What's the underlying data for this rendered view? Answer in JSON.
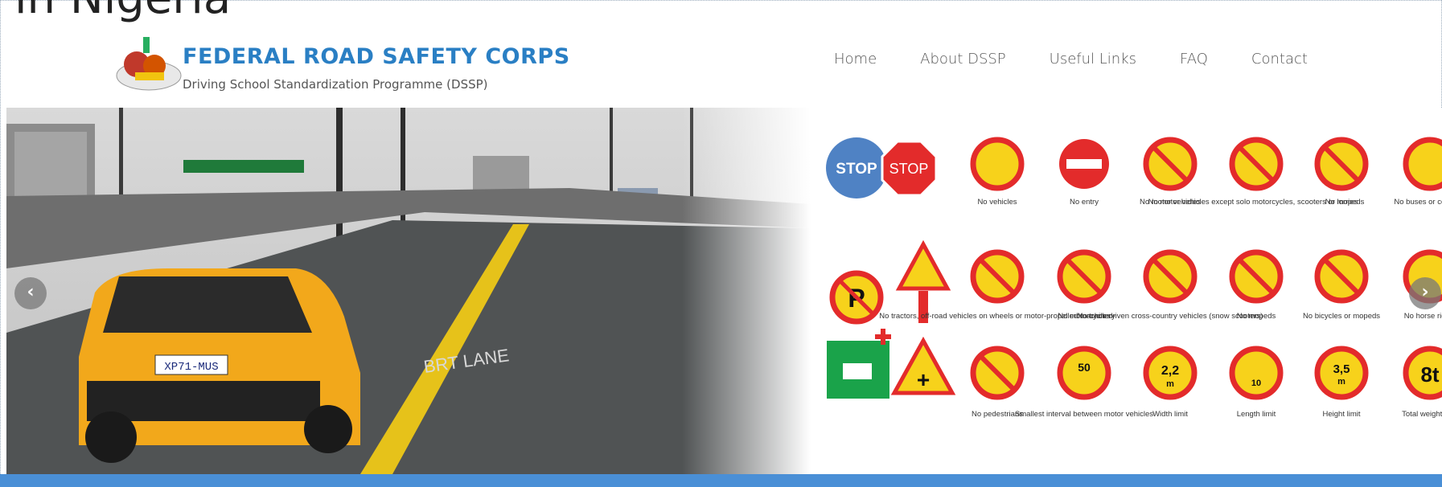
{
  "slide_title": "in Nigeria",
  "brand": {
    "name": "FEDERAL ROAD SAFETY CORPS",
    "subtitle": "Driving School Standardization Programme (DSSP)",
    "color": "#2a7fc4"
  },
  "nav": {
    "items": [
      "Home",
      "About DSSP",
      "Useful Links",
      "FAQ",
      "Contact"
    ]
  },
  "hero": {
    "plate": "XP71-MUS",
    "lane_text": "BRT LANE",
    "prev_icon": "‹",
    "next_icon": "›"
  },
  "signs": {
    "row1": {
      "stop1": "STOP",
      "stop2": "STOP",
      "labels": [
        "No vehicles",
        "No entry",
        "No motor vehicles",
        "No motor vehicles except solo motorcycles, scooters or mopeds",
        "No lorries",
        "No buses or coaches"
      ]
    },
    "row2": {
      "labels": [
        "No tractors, off-road vehicles on wheels or motor-propelled machinery",
        "No motorcycles",
        "No track-driven cross-country vehicles (snow scooters)",
        "No mopeds",
        "No bicycles or mopeds",
        "No horse riding"
      ]
    },
    "row3": {
      "labels": [
        "No pedestrians",
        "Smallest interval between motor vehicles",
        "Width limit",
        "Length limit",
        "Height limit",
        "Total weight limit"
      ],
      "interval_value": "50",
      "width_value": "2,2",
      "width_unit": "m",
      "length_value": "10",
      "height_value": "3,5",
      "height_unit": "m",
      "weight_value": "8t"
    }
  },
  "colors": {
    "accent_bar": "#4a8fd6",
    "sign_red": "#e32b2b",
    "sign_yellow": "#f7d21b",
    "taxi_yellow": "#f2a81b"
  }
}
